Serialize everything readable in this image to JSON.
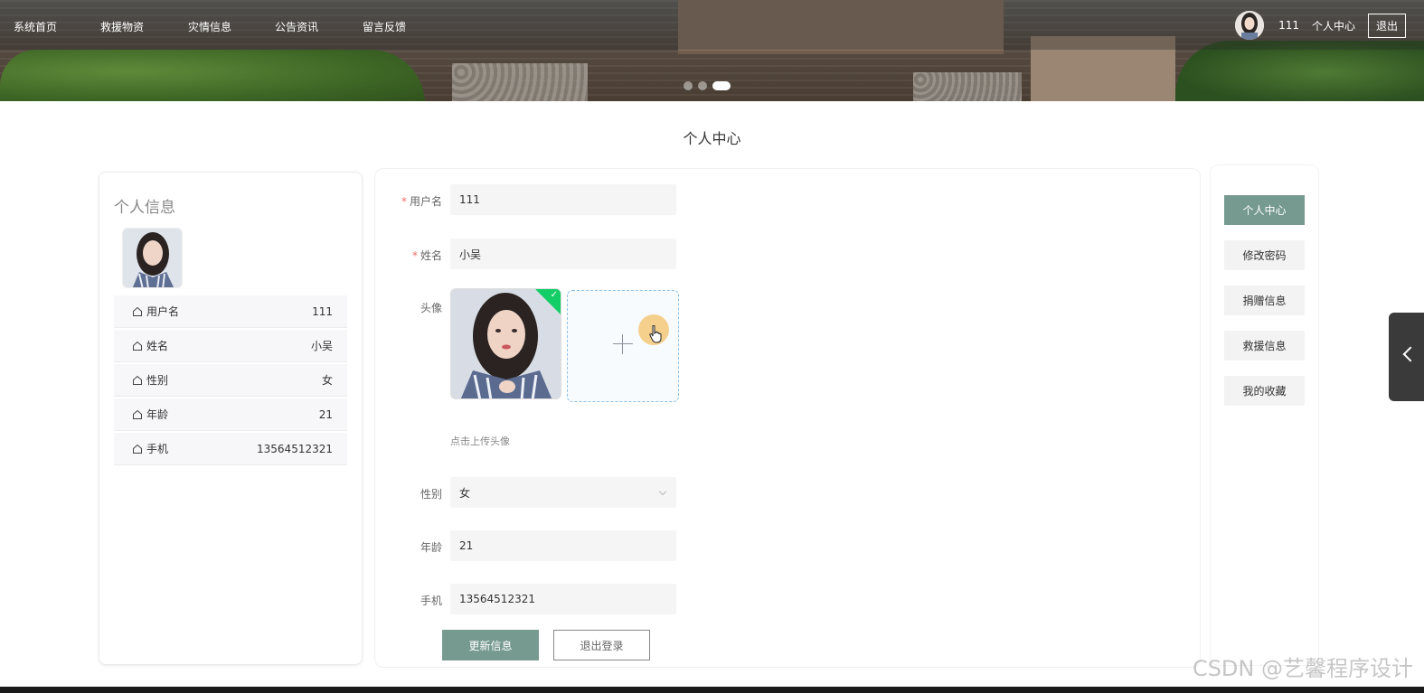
{
  "nav": {
    "items": [
      "系统首页",
      "救援物资",
      "灾情信息",
      "公告资讯",
      "留言反馈"
    ],
    "username": "111",
    "center_label": "个人中心",
    "logout_label": "退出"
  },
  "carousel": {
    "slide_count": 3,
    "active_index": 2
  },
  "page": {
    "title": "个人中心"
  },
  "profile": {
    "title": "个人信息",
    "rows": [
      {
        "label": "用户名",
        "value": "111"
      },
      {
        "label": "姓名",
        "value": "小吴"
      },
      {
        "label": "性别",
        "value": "女"
      },
      {
        "label": "年龄",
        "value": "21"
      },
      {
        "label": "手机",
        "value": "13564512321"
      }
    ]
  },
  "form": {
    "username_label": "用户名",
    "username_value": "111",
    "name_label": "姓名",
    "name_value": "小吴",
    "avatar_label": "头像",
    "upload_tip": "点击上传头像",
    "gender_label": "性别",
    "gender_value": "女",
    "age_label": "年龄",
    "age_value": "21",
    "phone_label": "手机",
    "phone_value": "13564512321",
    "update_button": "更新信息",
    "logout_button": "退出登录"
  },
  "sidebar": {
    "items": [
      "个人中心",
      "修改密码",
      "捐赠信息",
      "救援信息",
      "我的收藏"
    ],
    "active_index": 0
  },
  "watermark": "CSDN @艺馨程序设计",
  "colors": {
    "accent": "#769a90",
    "required": "#f56c6c",
    "success": "#13ce66"
  }
}
